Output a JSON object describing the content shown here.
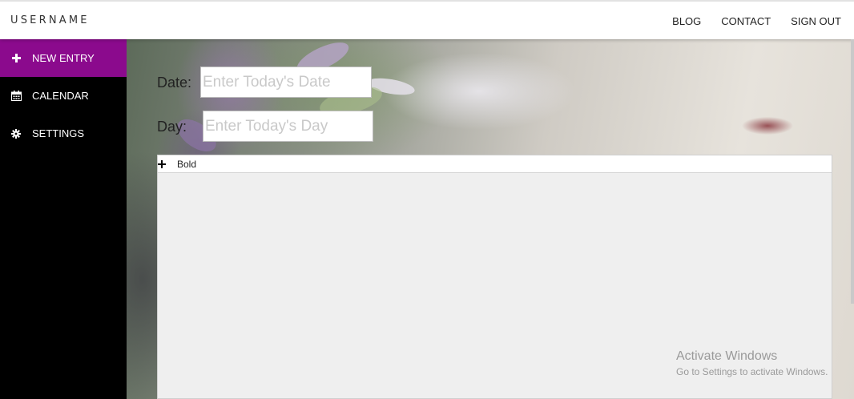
{
  "header": {
    "brand": "USERNAME",
    "links": [
      "BLOG",
      "CONTACT",
      "SIGN OUT"
    ]
  },
  "sidebar": {
    "items": [
      {
        "label": "NEW ENTRY",
        "icon": "plus-icon",
        "active": true
      },
      {
        "label": "CALENDAR",
        "icon": "calendar-icon",
        "active": false
      },
      {
        "label": "SETTINGS",
        "icon": "gear-icon",
        "active": false
      }
    ]
  },
  "form": {
    "date_label": "Date:",
    "date_placeholder": "Enter Today's Date",
    "day_label": "Day:",
    "day_placeholder": "Enter Today's Day"
  },
  "editor": {
    "toolbar": {
      "bold_label": "Bold",
      "bold_icon": "plus-icon"
    }
  },
  "watermark": {
    "title": "Activate Windows",
    "subtitle": "Go to Settings to activate Windows."
  },
  "colors": {
    "accent": "#8b0a8d",
    "sidebar_bg": "#000000",
    "editor_bg": "#efefef"
  }
}
